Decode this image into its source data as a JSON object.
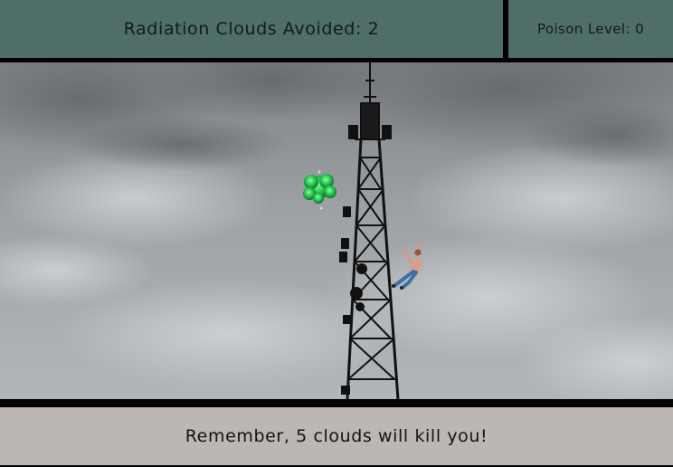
{
  "hud": {
    "score_label": "Radiation Clouds Avoided: 2",
    "poison_label": "Poison Level: 0"
  },
  "game": {
    "sprites": {
      "cloud": "radiation-cloud",
      "player": "climbing-man",
      "tower": "radio-tower"
    }
  },
  "footer": {
    "message": "Remember, 5 clouds will kill you!"
  },
  "colors": {
    "hud_bg": "#4f6e6a",
    "footer_bg": "#bcb6b4",
    "cloud_green": "#2fd15a"
  }
}
